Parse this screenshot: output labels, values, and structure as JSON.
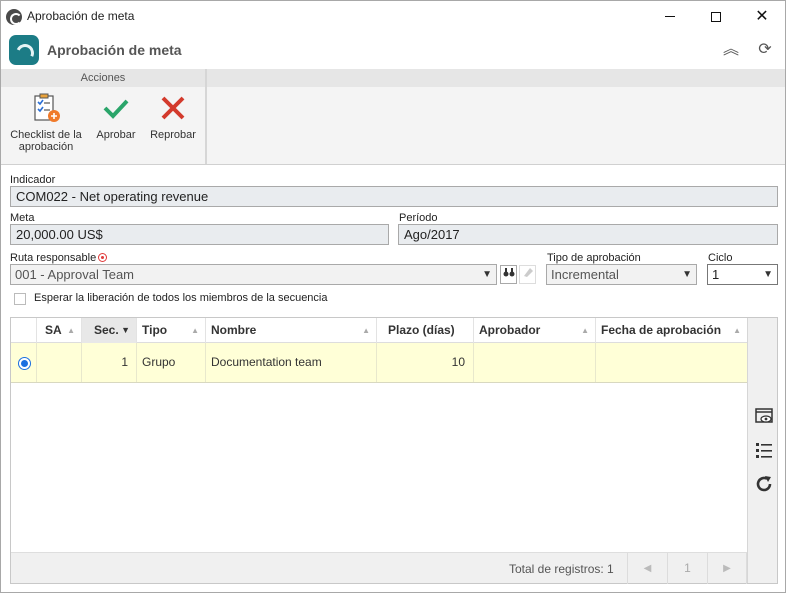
{
  "window": {
    "title": "Aprobación de meta",
    "minimize_icon": "minimize-icon",
    "maximize_icon": "maximize-icon",
    "close_icon": "close-icon",
    "close_glyph": "✕"
  },
  "header": {
    "title": "Aprobación de meta",
    "collapse_glyph": "︽",
    "refresh_glyph": "⟳"
  },
  "ribbon": {
    "group_label": "Acciones",
    "buttons": [
      {
        "label_line1": "Checklist de la",
        "label_line2": "aprobación",
        "icon": "checklist-icon"
      },
      {
        "label_line1": "Aprobar",
        "label_line2": "",
        "icon": "check-icon"
      },
      {
        "label_line1": "Reprobar",
        "label_line2": "",
        "icon": "cross-icon"
      }
    ]
  },
  "form": {
    "indicador": {
      "label": "Indicador",
      "value": "COM022 - Net operating revenue"
    },
    "meta": {
      "label": "Meta",
      "value": "20,000.00 US$"
    },
    "periodo": {
      "label": "Período",
      "value": "Ago/2017"
    },
    "ruta": {
      "label": "Ruta responsable",
      "value": "001 - Approval Team"
    },
    "tipo_aprobacion": {
      "label": "Tipo de aprobación",
      "value": "Incremental"
    },
    "ciclo": {
      "label": "Ciclo",
      "value": "1"
    },
    "esperar": {
      "label": "Esperar la liberación de todos los miembros de la secuencia",
      "checked": false
    }
  },
  "grid": {
    "columns": [
      "SA",
      "Sec.",
      "Tipo",
      "Nombre",
      "Plazo (días)",
      "Aprobador",
      "Fecha de aprobación"
    ],
    "rows": [
      {
        "selected": true,
        "sa": "",
        "sec": "1",
        "tipo": "Grupo",
        "nombre": "Documentation team",
        "plazo": "10",
        "aprobador": "",
        "fecha": ""
      }
    ],
    "footer": {
      "total_label": "Total de registros: 1",
      "page": "1"
    }
  },
  "colors": {
    "accent": "#1c7c86",
    "selected_row": "#ffffd7",
    "approve_green": "#2aa56a",
    "reject_red": "#d33a2c"
  }
}
